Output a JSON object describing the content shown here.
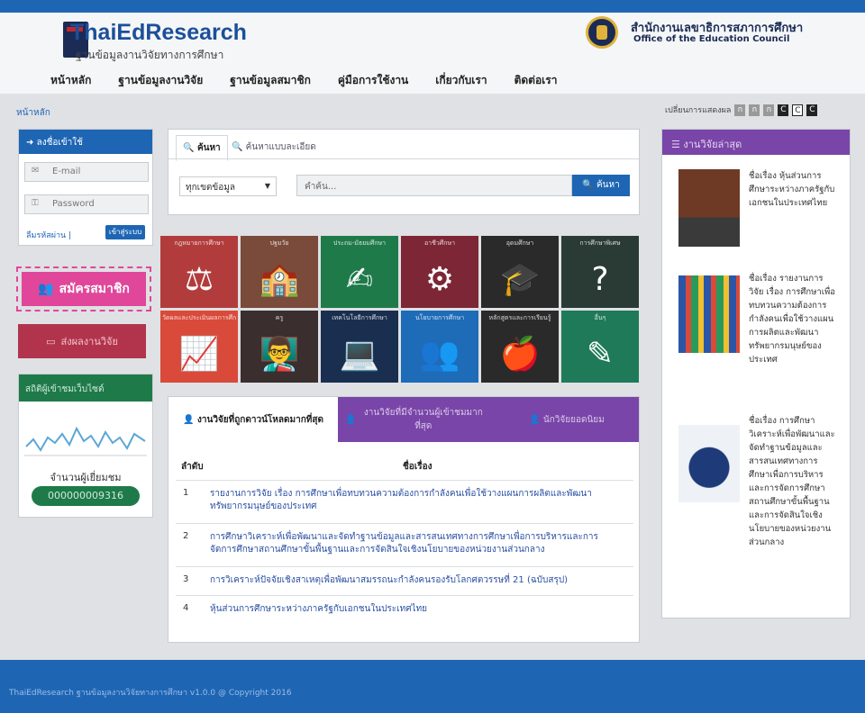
{
  "header": {
    "logo_title": "ThaiEdResearch",
    "logo_subtitle": "ฐานข้อมูลงานวิจัยทางการศึกษา",
    "office_th": "สำนักงานเลขาธิการสภาการศึกษา",
    "office_en": "Office of the Education Council",
    "nav": [
      "หน้าหลัก",
      "ฐานข้อมูลงานวิจัย",
      "ฐานข้อมูลสมาชิก",
      "คู่มือการใช้งาน",
      "เกี่ยวกับเรา",
      "ติดต่อเรา"
    ]
  },
  "breadcrumb": "หน้าหลัก",
  "font_size": {
    "label": "เปลี่ยนการแสดงผล",
    "buttons": [
      "ก",
      "ก",
      "ก",
      "C",
      "C",
      "C"
    ]
  },
  "login": {
    "title": "ลงชื่อเข้าใช้",
    "email_placeholder": "E-mail",
    "password_placeholder": "Password",
    "forgot": "ลืมรหัสผ่าน |",
    "submit": "เข้าสู่ระบบ"
  },
  "register": {
    "label": "สมัครสมาชิก"
  },
  "send_research": {
    "label": "ส่งผลงานวิจัย"
  },
  "stats": {
    "title": "สถิติผู้เข้าชมเว็บไซต์",
    "label": "จำนวนผู้เยี่ยมชม",
    "count": "000000009316"
  },
  "search": {
    "tab_basic": "ค้นหา",
    "tab_advanced": "ค้นหาแบบละเอียด",
    "select_value": "ทุกเขตข้อมูล",
    "placeholder": "คำค้น...",
    "button": "ค้นหา"
  },
  "tiles": [
    {
      "label": "กฎหมายการศึกษา",
      "color": "#b23c3c",
      "icon": "scales-icon",
      "glyph": "⚖"
    },
    {
      "label": "ปฐมวัย",
      "color": "#7a4a3a",
      "icon": "school-icon",
      "glyph": "🏫"
    },
    {
      "label": "ประถม-มัธยมศึกษา",
      "color": "#1f7a4a",
      "icon": "student-desk-icon",
      "glyph": "✍"
    },
    {
      "label": "อาชีวศึกษา",
      "color": "#7d2635",
      "icon": "gears-icon",
      "glyph": "⚙"
    },
    {
      "label": "อุดมศึกษา",
      "color": "#2a2a2a",
      "icon": "graduate-icon",
      "glyph": "🎓"
    },
    {
      "label": "การศึกษาพิเศษ",
      "color": "#2a3b36",
      "icon": "question-head-icon",
      "glyph": "?"
    },
    {
      "label": "วัดผลและประเมินผลการศึกษา",
      "color": "#d94a3a",
      "icon": "growth-chart-icon",
      "glyph": "📈"
    },
    {
      "label": "ครู",
      "color": "#3a2e2e",
      "icon": "teacher-icon",
      "glyph": "👨‍🏫"
    },
    {
      "label": "เทคโนโลยีการศึกษา",
      "color": "#1a2f50",
      "icon": "computer-icon",
      "glyph": "💻"
    },
    {
      "label": "นโยบายการศึกษา",
      "color": "#1e6bb8",
      "icon": "meeting-icon",
      "glyph": "👥"
    },
    {
      "label": "หลักสูตรและการเรียนรู้",
      "color": "#2a2a2a",
      "icon": "apple-book-icon",
      "glyph": "🍎"
    },
    {
      "label": "อื่นๆ",
      "color": "#1f7a5a",
      "icon": "edit-icon",
      "glyph": "✎"
    }
  ],
  "research": {
    "tabs": [
      "งานวิจัยที่ถูกดาวน์โหลดมากที่สุด",
      "งานวิจัยที่มีจำนวนผู้เข้าชมมากที่สุด",
      "นักวิจัยยอดนิยม"
    ],
    "col_no": "ลำดับ",
    "col_title": "ชื่อเรื่อง",
    "rows": [
      {
        "no": "1",
        "title": "รายงานการวิจัย เรื่อง การศึกษาเพื่อทบทวนความต้องการกำลังคนเพื่อใช้วางแผนการผลิตและพัฒนาทรัพยากรมนุษย์ของประเทศ"
      },
      {
        "no": "2",
        "title": "การศึกษาวิเคราะห์เพื่อพัฒนาและจัดทำฐานข้อมูลและสารสนเทศทางการศึกษาเพื่อการบริหารและการจัดการศึกษาสถานศึกษาขั้นพื้นฐานและการจัดสินใจเชิงนโยบายของหน่วยงานส่วนกลาง"
      },
      {
        "no": "3",
        "title": "การวิเคราะห์ปัจจัยเชิงสาเหตุเพื่อพัฒนาสมรรถนะกำลังคนรองรับโลกศตวรรษที่ 21 (ฉบับสรุป)"
      },
      {
        "no": "4",
        "title": "หุ้นส่วนการศึกษาระหว่างภาครัฐกับเอกชนในประเทศไทย"
      }
    ]
  },
  "latest": {
    "title": "งานวิจัยล่าสุด",
    "items": [
      {
        "text": "ชื่อเรื่อง หุ้นส่วนการศึกษาระหว่างภาครัฐกับเอกชนในประเทศไทย"
      },
      {
        "text": "ชื่อเรื่อง รายงานการวิจัย เรื่อง การศึกษาเพื่อทบทวนความต้องการกำลังคนเพื่อใช้วางแผนการผลิตและพัฒนาทรัพยากรมนุษย์ของประเทศ"
      },
      {
        "text": "ชื่อเรื่อง การศึกษาวิเคราะห์เพื่อพัฒนาและจัดทำฐานข้อมูลและสารสนเทศทางการศึกษาเพื่อการบริหารและการจัดการศึกษาสถานศึกษาขั้นพื้นฐานและการจัดสินใจเชิงนโยบายของหน่วยงานส่วนกลาง"
      }
    ]
  },
  "footer": "ThaiEdResearch ฐานข้อมูลงานวิจัยทางการศึกษา v1.0.0 @ Copyright 2016"
}
